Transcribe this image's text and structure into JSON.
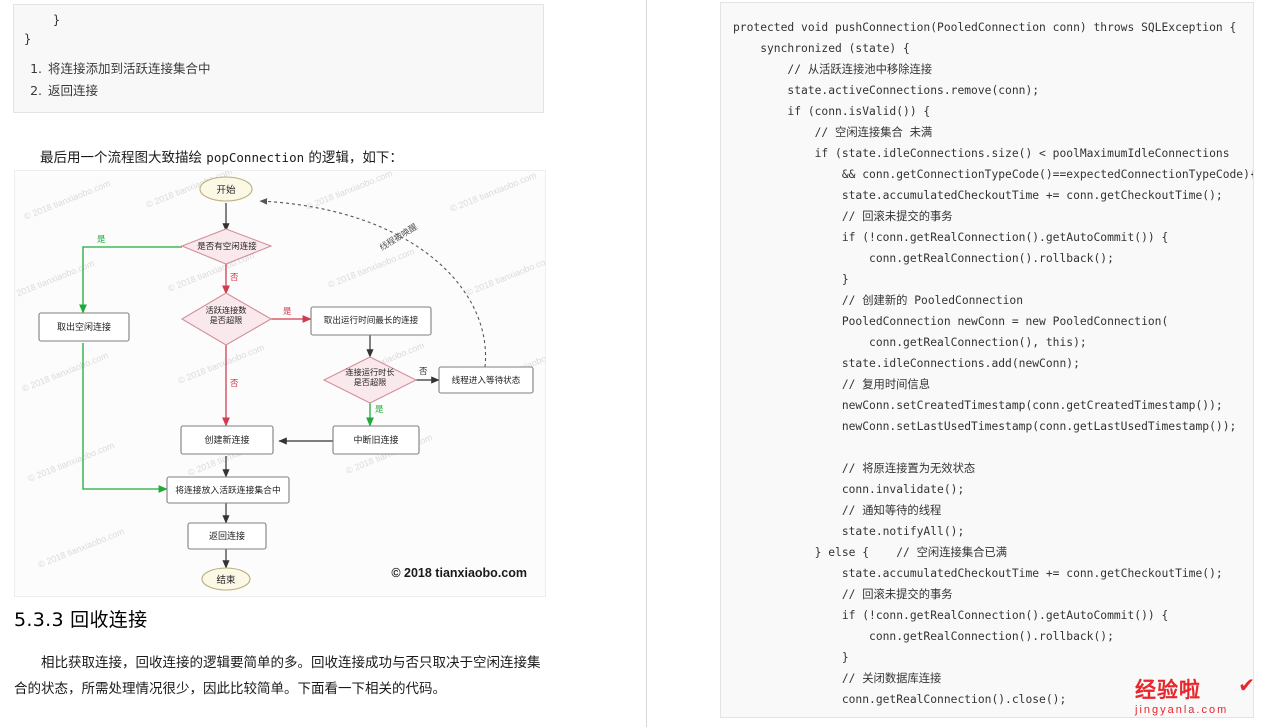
{
  "left": {
    "code_card": {
      "lines": [
        "    }",
        "}"
      ],
      "steps": [
        "将连接添加到活跃连接集合中",
        "返回连接"
      ]
    },
    "intro_paragraph_prefix": "最后用一个流程图大致描绘 ",
    "intro_paragraph_code": "popConnection",
    "intro_paragraph_suffix": " 的逻辑，如下：",
    "figure": {
      "nodes": {
        "start": "开始",
        "has_idle": "是否有空闲连接",
        "take_idle": "取出空闲连接",
        "active_over_limit": "活跃连接数\n是否超限",
        "take_longest": "取出运行时间最长的连接",
        "run_time_over": "连接运行时长\n是否超限",
        "thread_wait": "线程进入等待状态",
        "create_new": "创建新连接",
        "break_old": "中断旧连接",
        "put_active": "将连接放入活跃连接集合中",
        "return_conn": "返回连接",
        "end": "结束"
      },
      "edge_labels": {
        "yes1": "是",
        "no1": "否",
        "no2": "否",
        "yes2": "是",
        "no3": "否",
        "yes3": "是",
        "thread_wake": "线程被唤醒"
      },
      "watermarks": [
        "© 2018 tianxiaobo.com",
        "© 2018 tianxiaobo.com",
        "© 2018 tianxiaobo.com",
        "© 2018 tianxiaobo.com",
        "© 2018 tianxiaobo.com",
        "© 2018 tianxiaobo.com",
        "© 2018 tianxiaobo.com",
        "© 2018 tianxiaobo.com",
        "© 2018 tianxiaobo.com",
        "© 2018 tianxiaobo.com",
        "© 2018 tianxiaobo.com",
        "© 2018 tianxiaobo.com",
        "© 2018 tianxiaobo.com",
        "© 2018 tianxiaobo.com",
        "© 2018 tianxiaobo.com",
        "© 2018 tianxiaobo.com"
      ],
      "copyright": "© 2018 tianxiaobo.com"
    },
    "section_heading": "5.3.3 回收连接",
    "body_paragraph": "相比获取连接，回收连接的逻辑要简单的多。回收连接成功与否只取决于空闲连接集合的状态，所需处理情况很少，因此比较简单。下面看一下相关的代码。"
  },
  "right": {
    "code": "protected void pushConnection(PooledConnection conn) throws SQLException {\n    synchronized (state) {\n        // 从活跃连接池中移除连接\n        state.activeConnections.remove(conn);\n        if (conn.isValid()) {\n            // 空闲连接集合 未满\n            if (state.idleConnections.size() < poolMaximumIdleConnections\n                && conn.getConnectionTypeCode()==expectedConnectionTypeCode){\n                state.accumulatedCheckoutTime += conn.getCheckoutTime();\n                // 回滚未提交的事务\n                if (!conn.getRealConnection().getAutoCommit()) {\n                    conn.getRealConnection().rollback();\n                }\n                // 创建新的 PooledConnection\n                PooledConnection newConn = new PooledConnection(\n                    conn.getRealConnection(), this);\n                state.idleConnections.add(newConn);\n                // 复用时间信息\n                newConn.setCreatedTimestamp(conn.getCreatedTimestamp());\n                newConn.setLastUsedTimestamp(conn.getLastUsedTimestamp());\n\n                // 将原连接置为无效状态\n                conn.invalidate();\n                // 通知等待的线程\n                state.notifyAll();\n            } else {    // 空闲连接集合已满\n                state.accumulatedCheckoutTime += conn.getCheckoutTime();\n                // 回滚未提交的事务\n                if (!conn.getRealConnection().getAutoCommit()) {\n                    conn.getRealConnection().rollback();\n                }\n                // 关闭数据库连接\n                conn.getRealConnection().close();"
  },
  "badge": {
    "cn": "经验啦",
    "py": "jingyanla.com",
    "mark": "✔"
  }
}
